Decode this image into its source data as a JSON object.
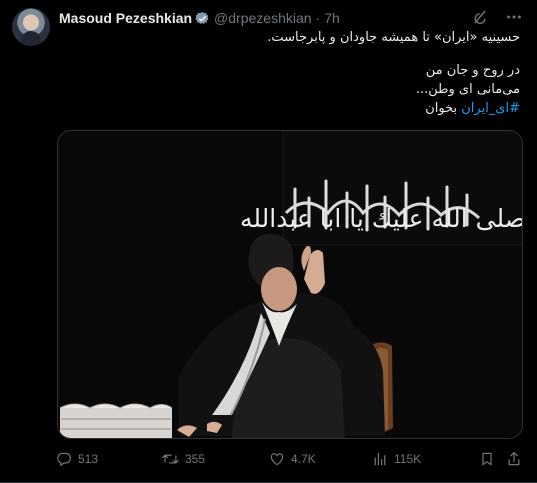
{
  "post": {
    "author_name": "Masoud Pezeshkian",
    "handle": "@drpezeshkian",
    "separator": "·",
    "time": "7h",
    "text": {
      "line1": "حسینیه «ایران» تا همیشه جاودان و پابرجاست.",
      "line2": "در روح و جان من",
      "line3": "می‌مانی ای وطن...",
      "hashtag": "#ای_ایران",
      "hashtag_suffix": " بخوان"
    },
    "media": {
      "calligraphy": "صلى الله عليك يا ابا عبدالله"
    }
  },
  "actions": {
    "replies": "513",
    "reposts": "355",
    "likes": "4.7K",
    "views": "115K"
  },
  "icons": [
    "grok-icon",
    "more-icon",
    "reply-icon",
    "repost-icon",
    "like-icon",
    "views-icon",
    "bookmark-icon",
    "share-icon",
    "verified-badge-icon"
  ],
  "colors": {
    "background": "#000000",
    "text": "#e7e9ea",
    "secondary": "#71767b",
    "link": "#1d9bf0",
    "verified": "#829aab"
  }
}
